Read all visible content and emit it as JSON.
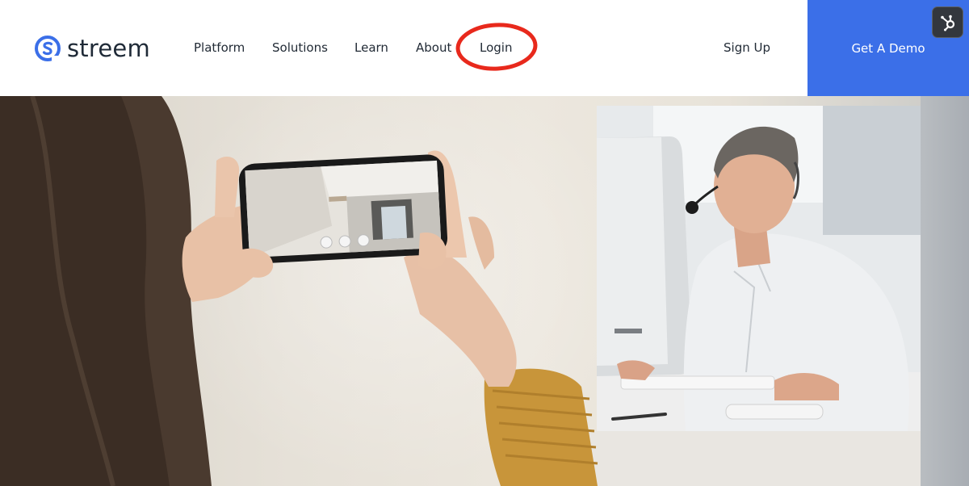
{
  "brand": {
    "name": "streem",
    "logo_icon": "streem-logo-icon",
    "accent_color": "#3b6fe8"
  },
  "nav": {
    "items": [
      {
        "key": "platform",
        "label": "Platform"
      },
      {
        "key": "solutions",
        "label": "Solutions"
      },
      {
        "key": "learn",
        "label": "Learn"
      },
      {
        "key": "about",
        "label": "About"
      },
      {
        "key": "login",
        "label": "Login"
      }
    ],
    "signup_label": "Sign Up",
    "demo_label": "Get A Demo"
  },
  "annotation": {
    "highlight_target": "login",
    "highlight_color": "#e8291c"
  },
  "hubspot": {
    "icon": "hubspot-sprocket-icon"
  },
  "hero": {
    "image_description": "woman-scanning-room-with-phone-and-remote-expert-at-desk"
  }
}
